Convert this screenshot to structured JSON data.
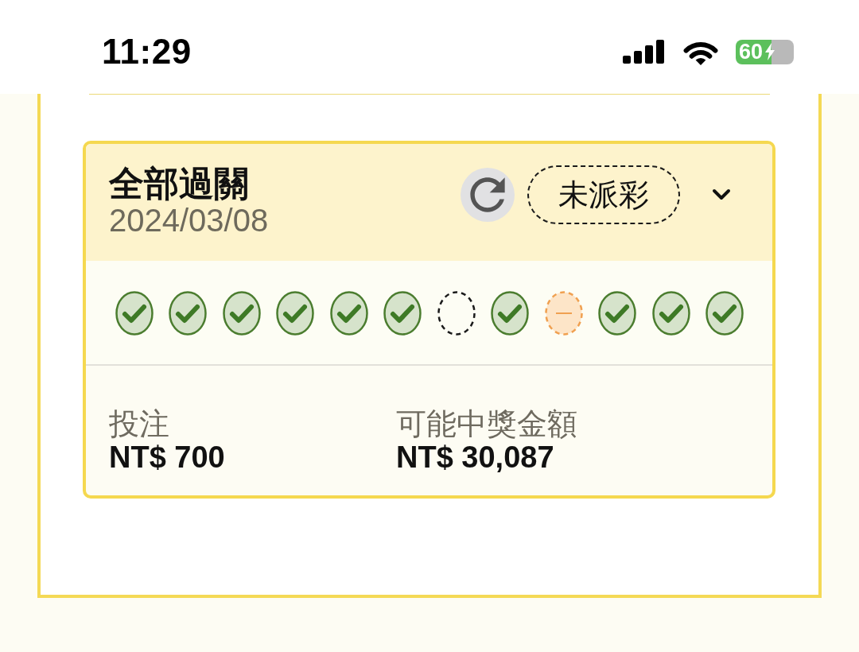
{
  "status_bar": {
    "time": "11:29",
    "battery_percent": "60"
  },
  "bet_card": {
    "title": "全部過關",
    "date": "2024/03/08",
    "status_badge": "未派彩",
    "expanded": false,
    "legs": [
      {
        "kind": "won"
      },
      {
        "kind": "won"
      },
      {
        "kind": "won"
      },
      {
        "kind": "won"
      },
      {
        "kind": "won"
      },
      {
        "kind": "won"
      },
      {
        "kind": "pending"
      },
      {
        "kind": "won"
      },
      {
        "kind": "void"
      },
      {
        "kind": "won"
      },
      {
        "kind": "won"
      },
      {
        "kind": "won"
      }
    ],
    "stake": {
      "label": "投注",
      "value": "NT$ 700"
    },
    "potential_payout": {
      "label": "可能中獎金額",
      "value": "NT$ 30,087"
    }
  }
}
